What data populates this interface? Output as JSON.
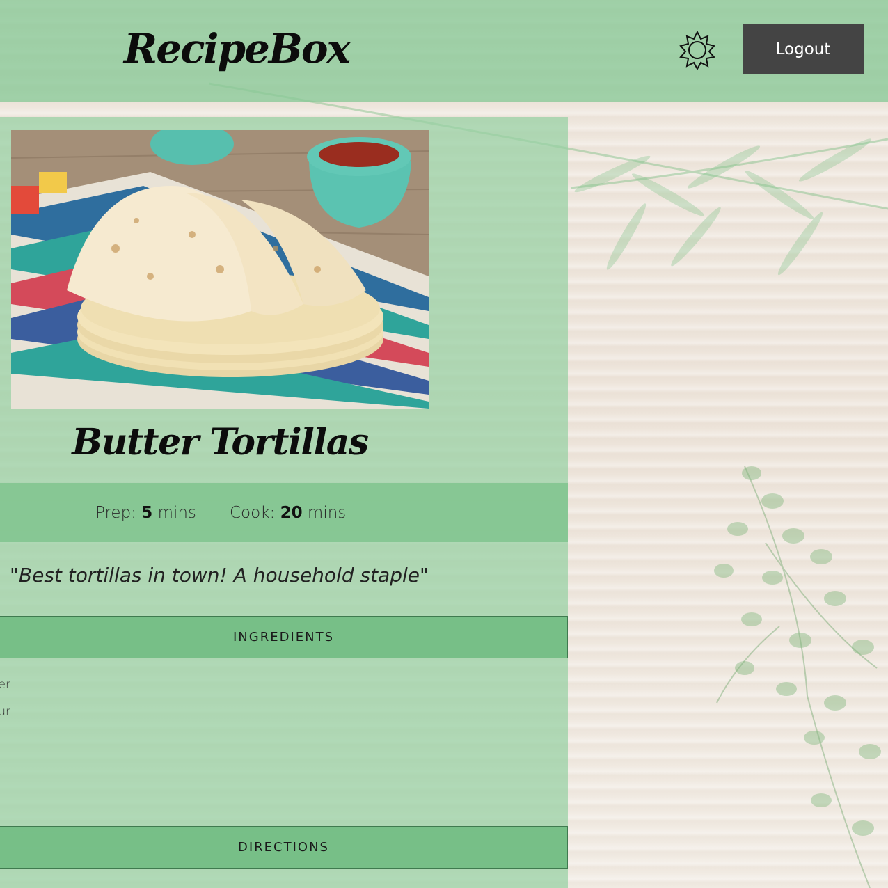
{
  "header": {
    "brand": "RecipeBox",
    "theme_toggle_icon": "sun-icon",
    "logout_label": "Logout"
  },
  "recipe": {
    "title": "Butter Tortillas",
    "photo_icon": "tortilla-photo",
    "prep_label": "Prep:",
    "prep_value": "5",
    "prep_unit": "mins",
    "cook_label": "Cook:",
    "cook_value": "20",
    "cook_unit": "mins",
    "quote": "\"Best tortillas in town! A household staple\""
  },
  "sections": {
    "ingredients_label": "INGREDIENTS",
    "directions_label": "DIRECTIONS"
  },
  "ingredients": [
    "er",
    "ur"
  ],
  "colors": {
    "header_bg": "#88c896",
    "card_bg": "#96d0a2",
    "section_bar": "#74be85",
    "logout_bg": "#444444"
  }
}
